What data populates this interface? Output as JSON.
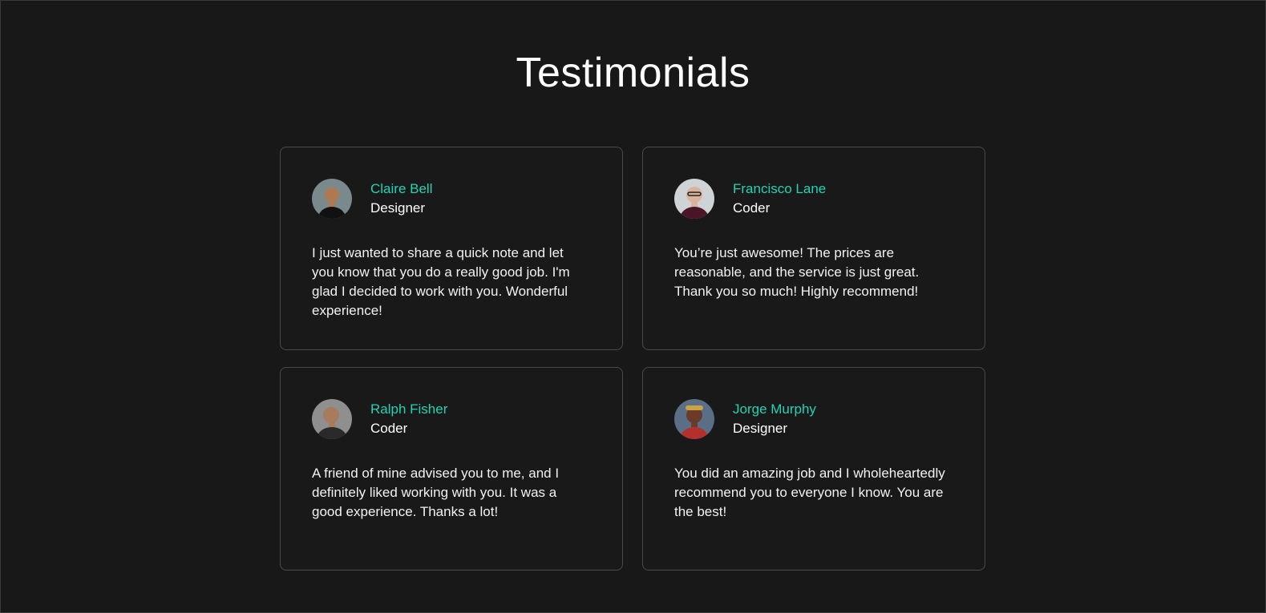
{
  "header": {
    "title": "Testimonials"
  },
  "testimonials": [
    {
      "name": "Claire Bell",
      "role": "Designer",
      "quote": "I just wanted to share a quick note and let you know that you do a really good job. I'm glad I decided to work with you. Wonderful experience!",
      "avatar_colors": {
        "bg": "#7a8a8c",
        "skin": "#b07850",
        "shirt": "#111111"
      }
    },
    {
      "name": "Francisco Lane",
      "role": "Coder",
      "quote": "You’re just awesome! The prices are reasonable, and the service is just great. Thank you so much! Highly recommend!",
      "avatar_colors": {
        "bg": "#cfd3d6",
        "skin": "#d9b49a",
        "shirt": "#4a1526"
      }
    },
    {
      "name": "Ralph Fisher",
      "role": "Coder",
      "quote": "A friend of mine advised you to me, and I definitely liked working with you. It was a good experience. Thanks a lot!",
      "avatar_colors": {
        "bg": "#8f8f8f",
        "skin": "#a77b5c",
        "shirt": "#2a2a2a"
      }
    },
    {
      "name": "Jorge Murphy",
      "role": "Designer",
      "quote": "You did an amazing job and I wholeheartedly recommend you to everyone I know. You are the best!",
      "avatar_colors": {
        "bg": "#5a6f86",
        "skin": "#6b3b2a",
        "shirt": "#b3302c"
      }
    }
  ],
  "colors": {
    "background": "#181818",
    "card_border": "#4a4a4a",
    "accent": "#22d3b5",
    "text": "#ffffff"
  }
}
